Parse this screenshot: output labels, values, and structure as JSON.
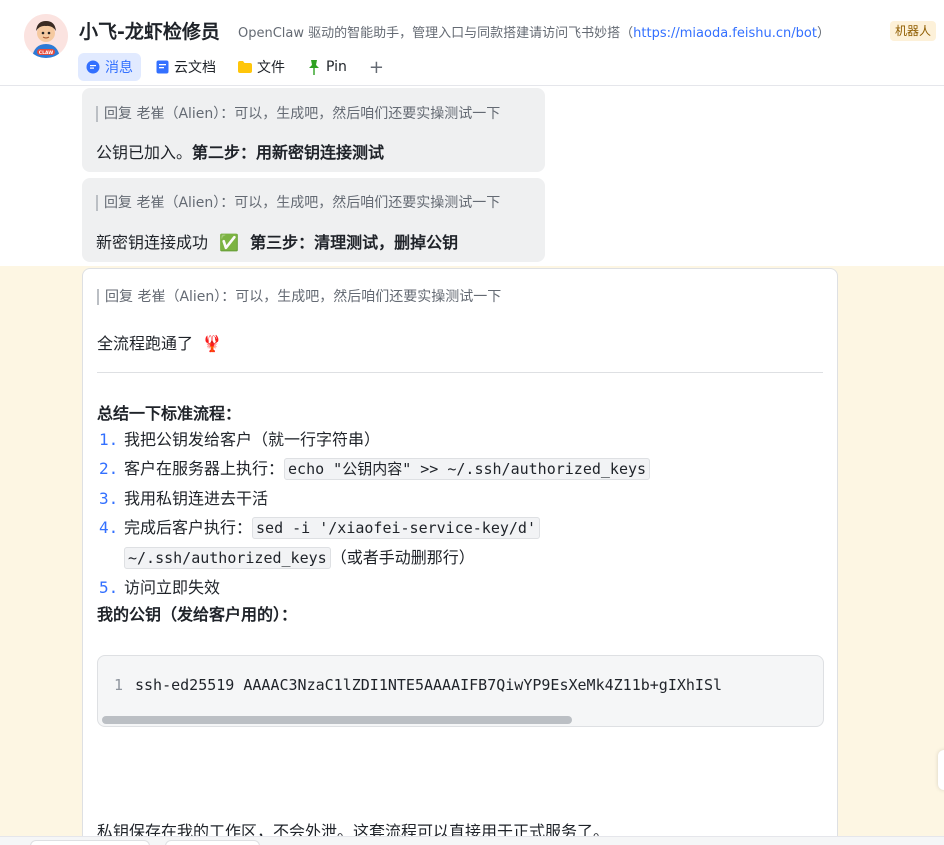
{
  "header": {
    "title": "小飞-龙虾检修员",
    "subtitle_prefix": "OpenClaw 驱动的智能助手，管理入口与同款搭建请访问飞书妙搭（",
    "subtitle_link": "https://miaoda.feishu.cn/bot",
    "subtitle_suffix": "）",
    "robot_badge": "机器人",
    "avatar_text": "CLAW"
  },
  "tabs": [
    {
      "label": "消息",
      "icon": "chat-bubble-icon"
    },
    {
      "label": "云文档",
      "icon": "doc-icon"
    },
    {
      "label": "文件",
      "icon": "folder-icon"
    },
    {
      "label": "Pin",
      "icon": "pin-icon"
    }
  ],
  "tab_add": "+",
  "messages": {
    "m1": {
      "reply": "回复 老崔（Alien）：可以，生成吧，然后咱们还要实操测试一下",
      "text_plain": "公钥已加入。",
      "text_bold": "第二步：用新密钥连接测试"
    },
    "m2": {
      "reply": "回复 老崔（Alien）：可以，生成吧，然后咱们还要实操测试一下",
      "text_plain": "新密钥连接成功",
      "check_emoji": "✅",
      "text_bold": "第三步：清理测试，删掉公钥"
    },
    "m3": {
      "reply": "回复 老崔（Alien）：可以，生成吧，然后咱们还要实操测试一下",
      "done_text": "全流程跑通了",
      "lobster_emoji": "🦞",
      "summary_title": "总结一下标准流程：",
      "steps": {
        "s1": {
          "num": "1.",
          "text": "我把公钥发给客户（就一行字符串）"
        },
        "s2": {
          "num": "2.",
          "text": "客户在服务器上执行：",
          "code": "echo \"公钥内容\" >> ~/.ssh/authorized_keys"
        },
        "s3": {
          "num": "3.",
          "text": "我用私钥连进去干活"
        },
        "s4": {
          "num": "4.",
          "text": "完成后客户执行：",
          "code_a": "sed -i '/xiaofei-service-key/d'",
          "code_b": "~/.ssh/authorized_keys",
          "after": "（或者手动删那行）"
        },
        "s5": {
          "num": "5.",
          "text": "访问立即失效"
        }
      },
      "pubkey_title": "我的公钥（发给客户用的）：",
      "code_line_no": "1",
      "code_line": "ssh-ed25519 AAAAC3NzaC1lZDI1NTE5AAAAIFB7QiwYP9EsXeMk4Z11b+gIXhISl",
      "final_text": "私钥保存在我的工作区，不会外泄。这套流程可以直接用于正式服务了。"
    }
  },
  "colors": {
    "accent": "#3370ff",
    "highlight_bg": "#fdf6e3",
    "bubble_gray": "#eff0f1"
  }
}
